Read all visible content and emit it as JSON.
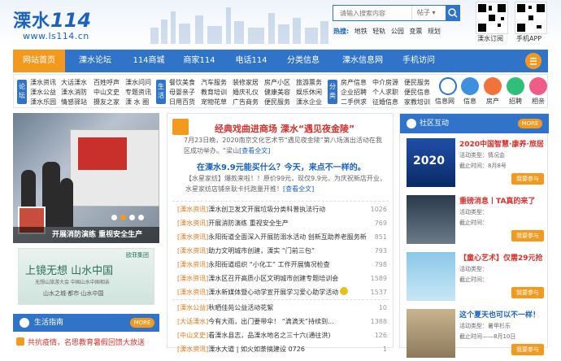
{
  "header": {
    "logo_cn": "溧水",
    "logo_num": "114",
    "logo_url": "www.ls114.cn",
    "search_placeholder": "请输入搜索内容",
    "search_select": "帖子",
    "hot_label": "热搜:",
    "hot_words": [
      "地铁",
      "轻轨",
      "公园",
      "变票",
      "规划"
    ],
    "qr1_label": "溧水订阅",
    "qr2_label": "手机APP"
  },
  "nav": {
    "items": [
      "网站首页",
      "溧水论坛",
      "114商城",
      "商家114",
      "电话114",
      "分类信息",
      "溧水信息网",
      "手机访问"
    ]
  },
  "subnav": {
    "tag1": "论坛",
    "tag2": "生活",
    "tag3": "分类",
    "col1": [
      "溧水资讯",
      "溧水公益",
      "溧水乐园"
    ],
    "col2": [
      "大话溧水",
      "溧水消防",
      "情感驿站"
    ],
    "col3": [
      "百姓呼声",
      "中山文史",
      "摄友之家"
    ],
    "col4": [
      "溧水问问",
      "专题资讯",
      "溧 水 圈"
    ],
    "col5": [
      "餐饮美食",
      "母婴亲子",
      "日用百货"
    ],
    "col6": [
      "汽车服务",
      "教育培训",
      "宠物花草"
    ],
    "col7": [
      "装修家居",
      "婚庆礼仪",
      "广告商务"
    ],
    "col8": [
      "房产小区",
      "健康美容",
      "便民服务"
    ],
    "col9": [
      "旅游票务",
      "娱乐休闲",
      "溧水企业"
    ],
    "col10": [
      "房产信息",
      "企业招聘",
      "二手供求"
    ],
    "col11": [
      "中介房源",
      "个人求职",
      "征婚信息"
    ],
    "col12": [
      "便民服务",
      "便民信息",
      "家教培训"
    ],
    "circles": [
      "信息网",
      "信息",
      "房产",
      "招聘",
      "相亲"
    ]
  },
  "slide": {
    "caption": "开展消防演练 重视安全生产"
  },
  "ad": {
    "line1": "上镜无想 山水中国",
    "line2": "无想山旅游大会 中国山水中国相亲",
    "line3": "山水之城·都市·山水中国",
    "brand": "欧菲集团"
  },
  "life": {
    "title": "生活指南",
    "more": "MORE",
    "item": "共抗疫情，名思教育暑假回馈大放送"
  },
  "middle": {
    "headline": "经典戏曲进商场 溧水“遇见夜金陵”",
    "para1_a": "7月23日晚，2020南京文化艺术节“遇见夜金陵”第八场演出活动在我区成功举办。“梁山",
    "para1_link": "[查看全文]",
    "headline2": "在溧水9.9元能买什么？今天，来点不一样的。",
    "para2_a": "【水星家纺】爆款来啦！！原价99元，现仅9.9元，为庆祝新店开业，水星家纺店铺亲耿卡托跑量开推！",
    "para2_link": "[查看全文]",
    "news": [
      {
        "cat": "[溧水资讯]",
        "title": "溧水创卫发文开展垃圾分类科普执法行动",
        "n": "1026"
      },
      {
        "cat": "[溧水资讯]",
        "title": "开展消防演练 重视安全生产",
        "n": "769"
      },
      {
        "cat": "[溧水资讯]",
        "title": "永阳街道全面深入开展防溺水活动 创新互助养老服务新",
        "n": "851"
      },
      {
        "cat": "[溧水资讯]",
        "title": "助力文明城市创建，溧实 “门前三包”",
        "n": "793"
      },
      {
        "cat": "[溧水资讯]",
        "title": "永阳街道组织 “小化工” 工作开展情况检查",
        "n": "798"
      },
      {
        "cat": "[溧水资讯]",
        "title": "溧水区召开高质小区文明城市创建专题培训会",
        "n": "1589"
      },
      {
        "cat": "[溧水资讯]",
        "title": "溧水新媒体暨心动学宣开展学习爱心助学活动",
        "n": "1537"
      },
      {
        "cat": "[溧水公益]",
        "title": "秋晒佳苑公益活动花絮",
        "n": "10"
      },
      {
        "cat": "[大话溧水]",
        "title": "今有大雨，出门要带伞！ “滴滴天”持续到...",
        "n": "1388"
      },
      {
        "cat": "[中山文史]",
        "title": "看溧水县志，品溧水地名之三十六(通往洪)",
        "n": "126"
      },
      {
        "cat": "[溧水资讯]",
        "title": "溧水大道 | 如火如荼搞建设 0726",
        "n": "1"
      }
    ]
  },
  "community": {
    "title": "社区互动",
    "more": "MORE",
    "events": [
      {
        "title": "2020中国智慧·康养·旅居",
        "m1": "活动类型：情况会",
        "m2": "截止时间：8月8号",
        "join": "我要参与",
        "img": "2020"
      },
      {
        "title": "重磅消息丨TA真的来了",
        "m1": "活动类型：",
        "m2": "截止时间：",
        "join": "我要参与",
        "img": ""
      },
      {
        "title": "【童心艺术】仅需29元抢",
        "m1": "活动类型：",
        "m2": "截止时间：",
        "join": "我要参与",
        "img": ""
      },
      {
        "title": "这个夏天也可以不一样！",
        "m1": "活动类型：暑甲杉乐",
        "m2": "截止时间——8月10日",
        "join": "我要参与",
        "img": ""
      }
    ]
  },
  "colors": {
    "primary": "#2f74c8",
    "accent": "#f39a1e",
    "red": "#d9302c",
    "orange": "#e8781a"
  }
}
